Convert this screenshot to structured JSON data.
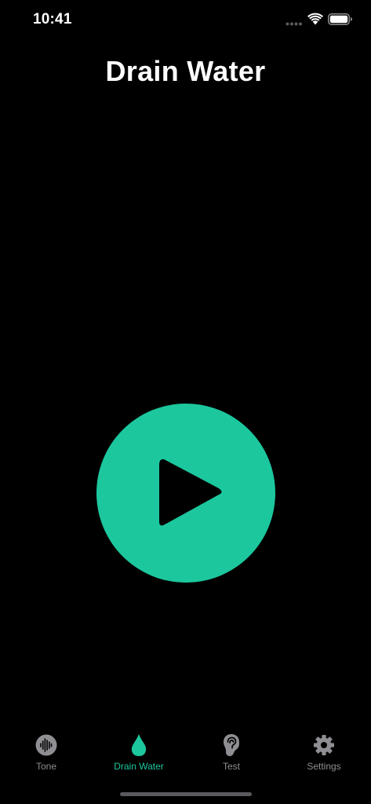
{
  "status_bar": {
    "time": "10:41",
    "signal_icon": "cellular-signal-icon",
    "wifi_icon": "wifi-icon",
    "battery_icon": "battery-icon"
  },
  "page": {
    "title": "Drain Water"
  },
  "play_button": {
    "icon": "play-icon"
  },
  "tabs": [
    {
      "label": "Tone",
      "icon": "waveform-icon",
      "active": false
    },
    {
      "label": "Drain Water",
      "icon": "water-drop-icon",
      "active": true
    },
    {
      "label": "Test",
      "icon": "ear-icon",
      "active": false
    },
    {
      "label": "Settings",
      "icon": "gear-icon",
      "active": false
    }
  ],
  "colors": {
    "background": "#000000",
    "accent": "#1cc79e",
    "text": "#ffffff",
    "tab_inactive": "#8e8e93",
    "home_indicator": "#5a5a5e"
  }
}
